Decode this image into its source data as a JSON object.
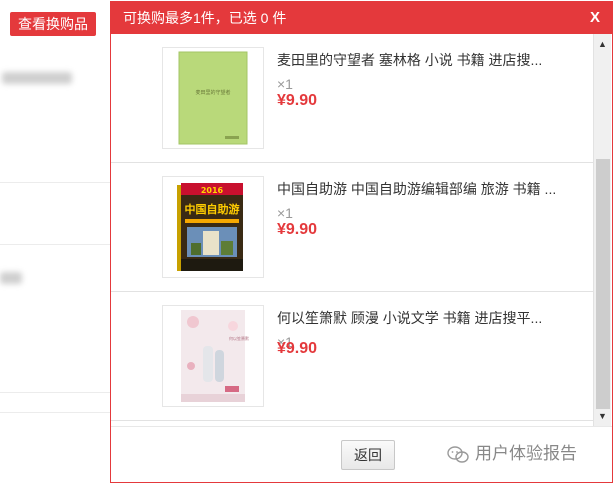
{
  "background_page": {
    "view_exchange_button": "查看换购品"
  },
  "modal": {
    "title": "可换购最多1件，已选 0 件",
    "close_label": "X",
    "items": [
      {
        "name": "麦田里的守望者 塞林格 小说 书籍 进店搜...",
        "qty": "×1",
        "price": "¥9.90",
        "cover_text": "麦田里的守望者"
      },
      {
        "name": "中国自助游 中国自助游编辑部编 旅游 书籍 ...",
        "qty": "×1",
        "price": "¥9.90",
        "cover_text": "中国自助游",
        "cover_year": "2016"
      },
      {
        "name": "何以笙箫默 顾漫 小说文学 书籍 进店搜平...",
        "qty": "×1",
        "price": "¥9.90",
        "cover_text": "何以笙箫默"
      }
    ],
    "back_button": "返回"
  },
  "watermark": {
    "text": "用户体验报告"
  },
  "colors": {
    "accent": "#e4393c"
  }
}
